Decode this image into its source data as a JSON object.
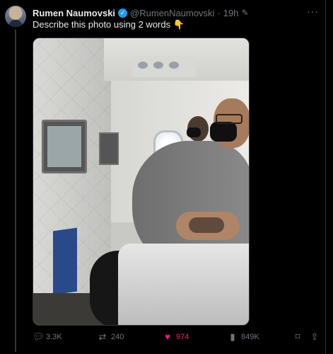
{
  "tweet": {
    "author_name": "Rumen Naumovski",
    "handle": "@RumenNaumovski",
    "separator": "·",
    "time": "19h",
    "text": "Describe this photo using 2 words",
    "emoji": "👇",
    "more": "···",
    "media_alt_semantic": "airplane cabin photo"
  },
  "actions": {
    "replies": "3.3K",
    "retweets": "240",
    "likes": "974",
    "views": "849K"
  },
  "colors": {
    "background": "#000000",
    "text": "#e7e9ea",
    "muted": "#71767b",
    "verified": "#1d9bf0",
    "like": "#f91880"
  }
}
